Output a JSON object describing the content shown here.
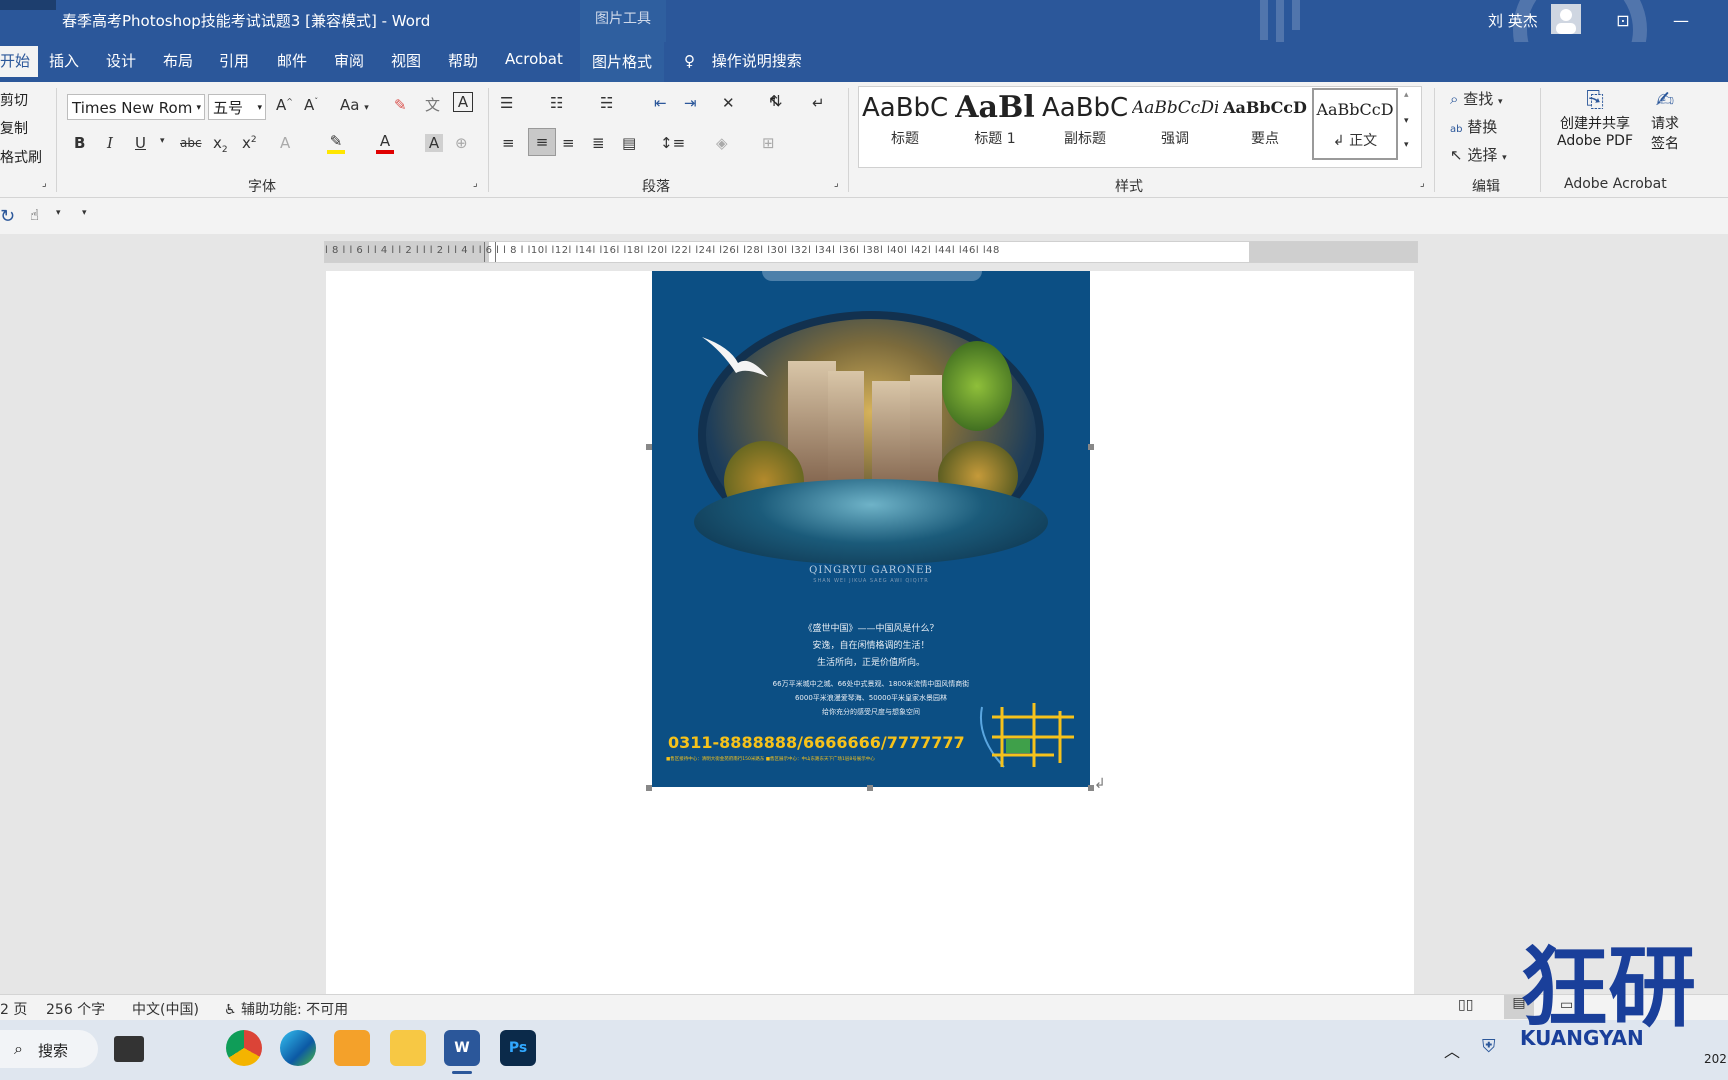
{
  "window": {
    "title": "春季高考Photoshop技能考试试题3 [兼容模式]  -  Word",
    "picture_tools": "图片工具",
    "user_name": "刘 英杰"
  },
  "tabs": [
    "开始",
    "插入",
    "设计",
    "布局",
    "引用",
    "邮件",
    "审阅",
    "视图",
    "帮助",
    "Acrobat",
    "图片格式"
  ],
  "tell_me": "操作说明搜索",
  "clipboard": {
    "cut": "剪切",
    "copy": "复制",
    "format_painter": "格式刷"
  },
  "font": {
    "name": "Times New Rom",
    "size": "五号",
    "group_label": "字体",
    "change_case": "Aa",
    "bold": "B",
    "italic": "I",
    "underline": "U",
    "strike": "abc"
  },
  "paragraph": {
    "group_label": "段落"
  },
  "styles": {
    "group_label": "样式",
    "items": [
      {
        "sample": "AaBbC",
        "label": "标题"
      },
      {
        "sample": "AaBl",
        "label": "标题 1"
      },
      {
        "sample": "AaBbC",
        "label": "副标题"
      },
      {
        "sample": "AaBbCcDi",
        "label": "强调"
      },
      {
        "sample": "AaBbCcD",
        "label": "要点"
      },
      {
        "sample": "AaBbCcD",
        "label": "↲ 正文"
      }
    ]
  },
  "editing": {
    "group_label": "编辑",
    "find": "查找",
    "replace": "替换",
    "select": "选择"
  },
  "acrobat": {
    "create_share": "创建并共享",
    "adobe_pdf": "Adobe PDF",
    "request_sign_1": "请求",
    "request_sign_2": "签名",
    "group_label": "Adobe Acrobat"
  },
  "ruler": {
    "ticks": "l 8 l   l 6 l   l 4 l   l 2 l      l      l 2 l   l 4 l   l 6 l   l 8 l   l10l   l12l   l14l   l16l   l18l   l20l   l22l   l24l   l26l   l28l   l30l   l32l   l34l   l36l   l38l   l40l   l42l   l44l   l46l   l48"
  },
  "poster": {
    "brand": "QINGRYU GARONEB",
    "brand_sub": "SHAN WEI JIKUA SAEG AWI QIQITR",
    "line1": "《盛世中国》——中国风是什么？",
    "line2": "安逸，自在闲情格调的生活！",
    "line3": "生活所向，正是价值所向。",
    "line4": "66万平米城中之城、66处中式景观、1800米流情中国风情商街",
    "line5": "6000平米浪漫爱琴海、50000平米皇家水景园林",
    "line6": "给你充分的感受尺度与想象空间",
    "phone": "0311-8888888/6666666/7777777",
    "address": "■售区接待中心：清明大街金苑府南行150米路东    ■售区展示中心：中山东路东天下广场1层8号展示中心"
  },
  "status": {
    "page": "2 页",
    "words": "256 个字",
    "language": "中文(中国)",
    "accessibility": "辅助功能: 不可用"
  },
  "taskbar": {
    "search": "搜索",
    "watermark": "狂研",
    "watermark_latin": "KUANGYAN",
    "clock_fragment": "202"
  },
  "colors": {
    "word_blue": "#2b579a",
    "ribbon_bg": "#f3f3f3",
    "poster_bg": "#0c4f84",
    "phone_yellow": "#f6c21b"
  }
}
